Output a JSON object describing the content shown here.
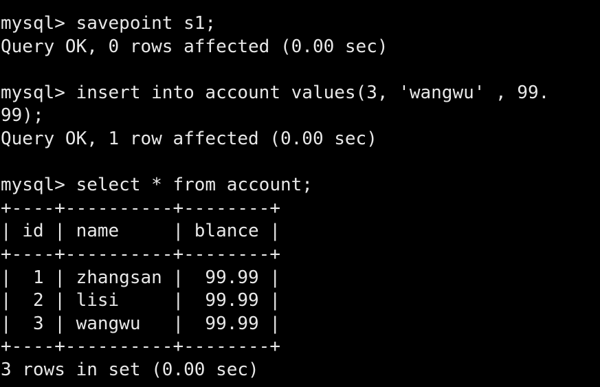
{
  "terminal": {
    "background_color": "#000000",
    "foreground_color": "#e8e8e8",
    "prompt": "mysql>",
    "lines": [
      {
        "id": "savepoint-command",
        "text": "mysql> savepoint s1;"
      },
      {
        "id": "savepoint-result",
        "text": "Query OK, 0 rows affected (0.00 sec)"
      },
      {
        "id": "blank-1",
        "text": " "
      },
      {
        "id": "insert-command-part1",
        "text": "mysql> insert into account values(3, 'wangwu' , 99."
      },
      {
        "id": "insert-command-part2",
        "text": "99);"
      },
      {
        "id": "insert-result",
        "text": "Query OK, 1 row affected (0.00 sec)"
      },
      {
        "id": "blank-2",
        "text": " "
      },
      {
        "id": "select-command",
        "text": "mysql> select * from account;"
      },
      {
        "id": "table-top-border",
        "text": "+----+----------+--------+"
      },
      {
        "id": "table-header-row",
        "text": "| id | name     | blance |"
      },
      {
        "id": "table-header-separator",
        "text": "+----+----------+--------+"
      },
      {
        "id": "table-row-1",
        "text": "|  1 | zhangsan |  99.99 |"
      },
      {
        "id": "table-row-2",
        "text": "|  2 | lisi     |  99.99 |"
      },
      {
        "id": "table-row-3",
        "text": "|  3 | wangwu   |  99.99 |"
      },
      {
        "id": "table-bottom-border",
        "text": "+----+----------+--------+"
      },
      {
        "id": "select-result",
        "text": "3 rows in set (0.00 sec)"
      }
    ]
  },
  "result_table": {
    "columns": [
      "id",
      "name",
      "blance"
    ],
    "rows": [
      {
        "id": "1",
        "name": "zhangsan",
        "blance": "99.99"
      },
      {
        "id": "2",
        "name": "lisi",
        "blance": "99.99"
      },
      {
        "id": "3",
        "name": "wangwu",
        "blance": "99.99"
      }
    ],
    "row_count_text": "3 rows in set (0.00 sec)"
  }
}
